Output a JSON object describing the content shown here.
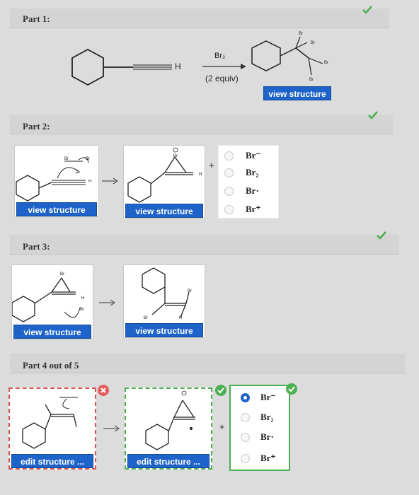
{
  "parts": [
    {
      "label": "Part 1:"
    },
    {
      "label": "Part 2:"
    },
    {
      "label": "Part 3:"
    },
    {
      "label": "Part 4 out of 5"
    }
  ],
  "part1": {
    "reagent": "Br₂",
    "equiv": "(2 equiv)",
    "h_label": "H",
    "view_btn": "view structure",
    "atoms": {
      "br_top": "Br",
      "br_right": "Br",
      "br_far": "Br",
      "br_bottom": "Br"
    }
  },
  "part2": {
    "view_btn_left": "view structure",
    "view_btn_right": "view structure",
    "plus": "+",
    "options": [
      "Br⁻",
      "Br₂",
      "Br·",
      "Br⁺"
    ],
    "atoms": {
      "br1": "Br",
      "br2": "Br",
      "h1": "H",
      "h2": "H",
      "br_top": "Br"
    }
  },
  "part3": {
    "view_btn_left": "view structure",
    "view_btn_right": "view structure",
    "atoms": {
      "br1": "Br",
      "br2": "Br",
      "h1": "H",
      "br3": "Br",
      "br4": "Br",
      "h2": "H"
    }
  },
  "part4": {
    "edit_btn_left": "edit structure ...",
    "edit_btn_right": "edit structure ...",
    "plus": "+",
    "options": [
      "Br⁻",
      "Br₂",
      "Br·",
      "Br⁺"
    ],
    "selected_index": 0,
    "status": {
      "left": "incorrect",
      "middle": "correct",
      "options": "correct"
    }
  },
  "colors": {
    "accent": "#1d63c9",
    "check": "#4caf50",
    "wrong": "#e35d5d",
    "dash_red": "#d9534f",
    "dash_green": "#4caf50"
  }
}
